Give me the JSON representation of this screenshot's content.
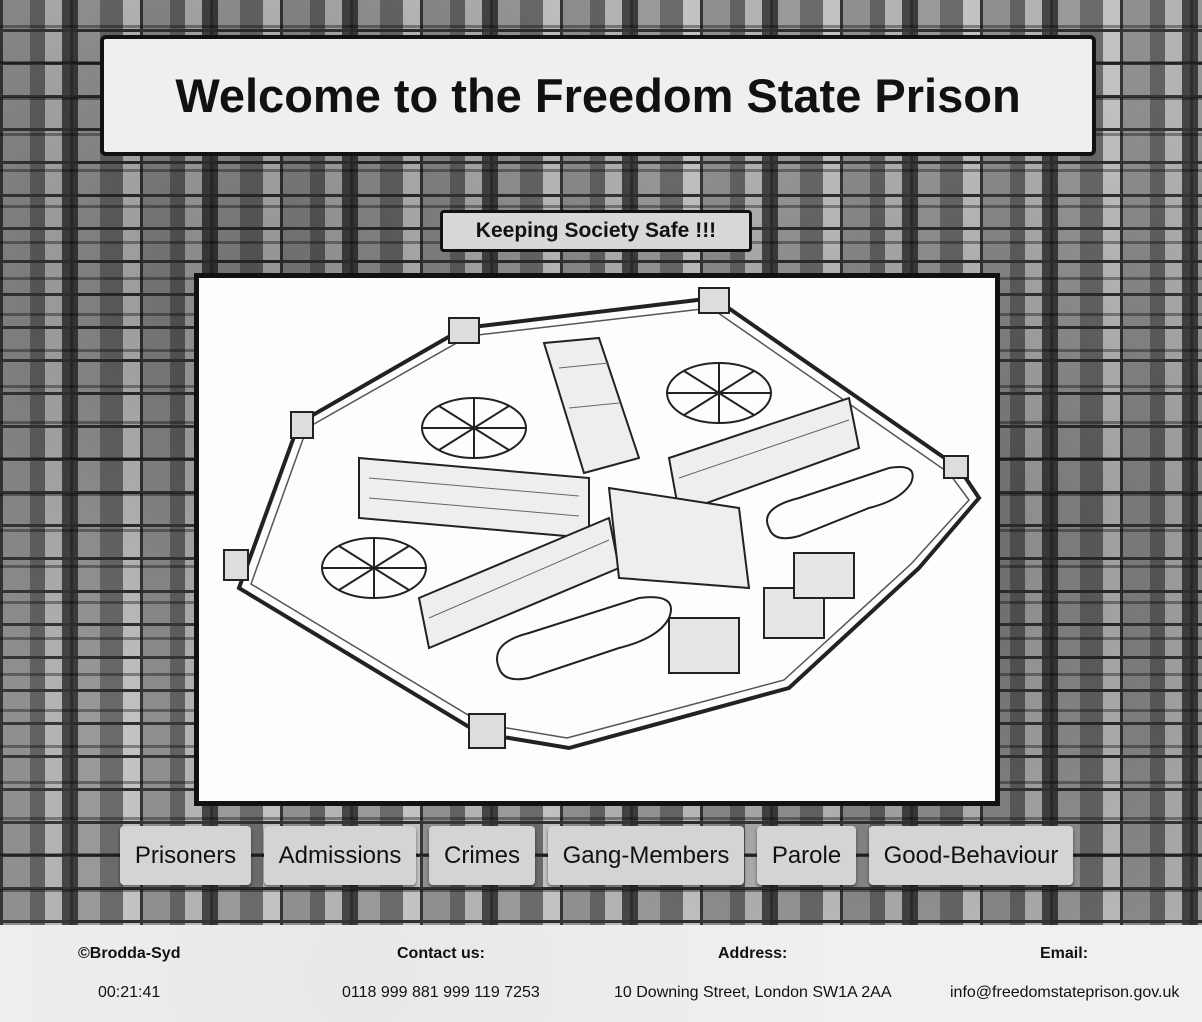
{
  "header": {
    "title": "Welcome to the Freedom State Prison",
    "tagline": "Keeping Society Safe !!!"
  },
  "nav": {
    "items": [
      {
        "label": "Prisoners"
      },
      {
        "label": "Admissions"
      },
      {
        "label": "Crimes"
      },
      {
        "label": "Gang-Members"
      },
      {
        "label": "Parole"
      },
      {
        "label": "Good-Behaviour"
      }
    ]
  },
  "footer": {
    "copyright": "©Brodda-Syd",
    "clock": "00:21:41",
    "contact_heading": "Contact us:",
    "contact_phone": "0118 999 881 999 119 7253",
    "address_heading": "Address:",
    "address": "10 Downing Street, London SW1A 2AA",
    "email_heading": "Email:",
    "email": "info@freedomstateprison.gov.uk"
  },
  "colors": {
    "title_bg": "#efefef",
    "button_bg": "#d4d4d4",
    "footer_bg": "#f0f0f0",
    "border": "#111111"
  }
}
